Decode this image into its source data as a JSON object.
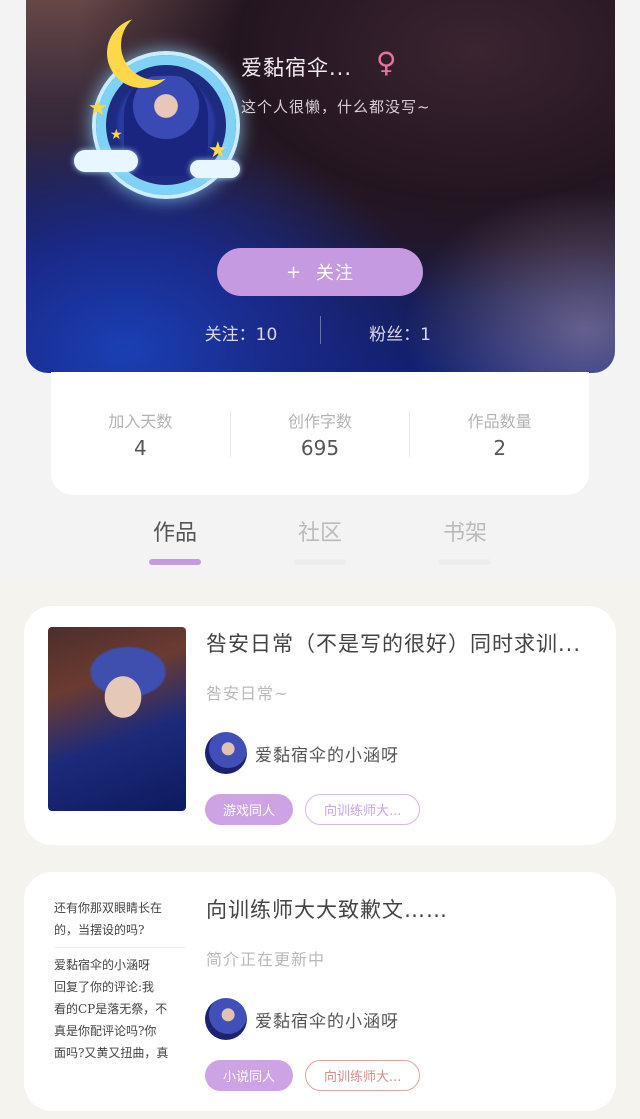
{
  "profile": {
    "username": "爱黏宿伞...",
    "gender_symbol": "♀",
    "bio": "这个人很懒，什么都没写~",
    "follow_button": {
      "icon": "+",
      "label": "关注"
    },
    "following": "关注：10",
    "followers": "粉丝：1"
  },
  "stats": [
    {
      "label": "加入天数",
      "value": "4"
    },
    {
      "label": "创作字数",
      "value": "695"
    },
    {
      "label": "作品数量",
      "value": "2"
    }
  ],
  "tabs": [
    {
      "label": "作品",
      "active": true
    },
    {
      "label": "社区",
      "active": false
    },
    {
      "label": "书架",
      "active": false
    }
  ],
  "works": [
    {
      "title": "咎安日常（不是写的很好）同时求训...",
      "description": "咎安日常~",
      "author": "爱黏宿伞的小涵呀",
      "tags": [
        "游戏同人",
        "向训练师大..."
      ]
    },
    {
      "title": "向训练师大大致歉文……",
      "description": "简介正在更新中",
      "author": "爱黏宿伞的小涵呀",
      "tags": [
        "小说同人",
        "向训练师大..."
      ],
      "cover_text": [
        "还有你那双眼睛长在",
        "的，当摆设的吗?",
        "爱黏宿伞的小涵呀",
        "回复了你的评论:我",
        "看的CP是落无祭，不",
        "真是你配评论吗?你",
        "面吗?又黄又扭曲，真"
      ]
    }
  ]
}
